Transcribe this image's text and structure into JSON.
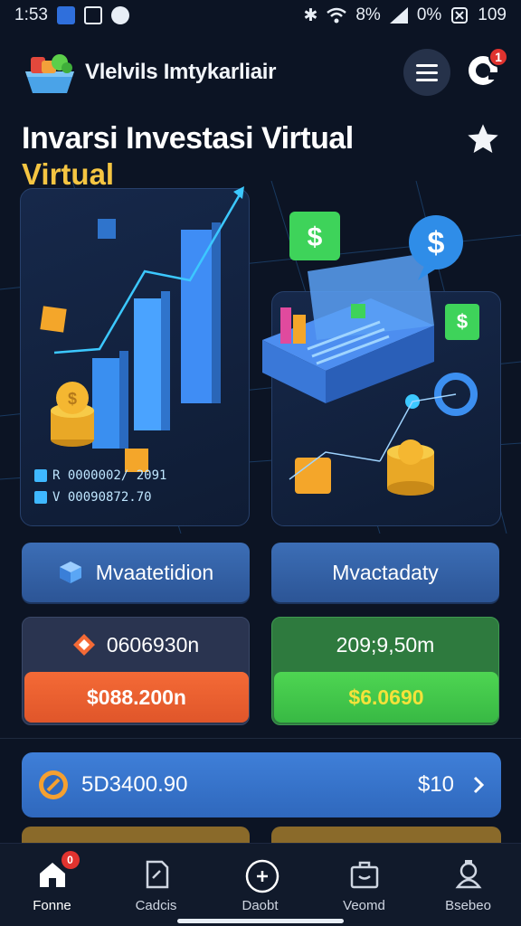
{
  "status_bar": {
    "time": "1:53",
    "battery_text": "8%",
    "signal_text": "0%",
    "right_text": "109"
  },
  "header": {
    "app_title": "Vlelvils Imtykarliair",
    "notification_count": "1"
  },
  "hero": {
    "title": "Invarsi Investasi Virtual",
    "subtitle": "Virtual"
  },
  "illustration": {
    "code_lines": [
      "R 0000002/ 2091",
      "V 00090872.70"
    ],
    "colors": {
      "bar": "#4aa3ff",
      "coin": "#f5b731",
      "cube_green": "#3ed35a",
      "cube_orange": "#f4a62a",
      "accent_line": "#3cc8ff"
    }
  },
  "actions": {
    "left_label": "Mvaatetidion",
    "right_label": "Mvactadaty"
  },
  "stats": {
    "left": {
      "value": "0606930n",
      "button": "$088.200n"
    },
    "right": {
      "value": "209;9,50m",
      "button": "$6.0690"
    }
  },
  "balance": {
    "value": "5D3400.90",
    "right_value": "$10"
  },
  "nav": {
    "items": [
      {
        "label": "Fonne",
        "icon": "home-icon",
        "badge": "0"
      },
      {
        "label": "Cadcis",
        "icon": "document-icon"
      },
      {
        "label": "Daobt",
        "icon": "target-icon"
      },
      {
        "label": "Veomd",
        "icon": "briefcase-icon"
      },
      {
        "label": "Bsebeo",
        "icon": "support-icon"
      }
    ]
  },
  "theme": {
    "background": "#0c1424",
    "accent_blue": "#3f7fd8",
    "accent_orange": "#f46a36",
    "accent_green": "#38b944",
    "title_yellow": "#f5c542"
  }
}
